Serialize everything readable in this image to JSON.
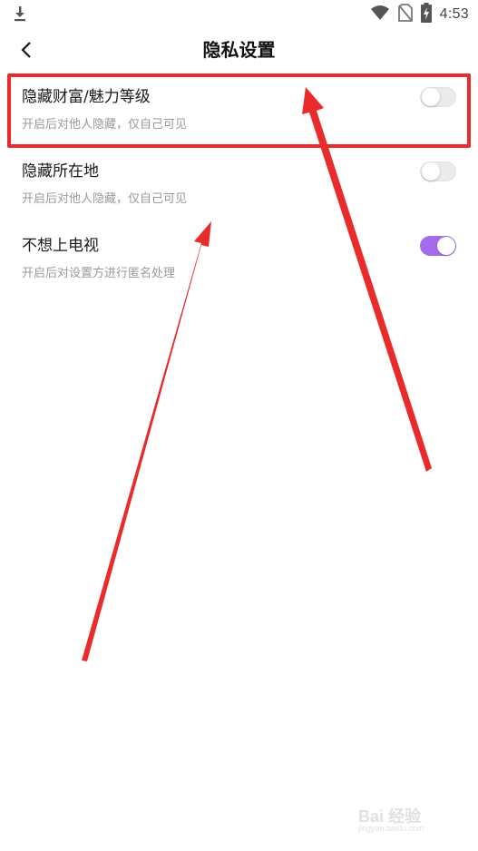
{
  "status_bar": {
    "time": "4:53",
    "icons": [
      "download-icon",
      "wifi-icon",
      "no-sim-icon",
      "battery-charging-icon"
    ]
  },
  "header": {
    "title": "隐私设置",
    "back_icon": "chevron-left-icon"
  },
  "settings": [
    {
      "title": "隐藏财富/魅力等级",
      "description": "开启后对他人隐藏，仅自己可见",
      "enabled": false
    },
    {
      "title": "隐藏所在地",
      "description": "开启后对他人隐藏，仅自己可见",
      "enabled": false
    },
    {
      "title": "不想上电视",
      "description": "开启后对设置方进行匿名处理",
      "enabled": true
    }
  ],
  "colors": {
    "accent": "#a46bec",
    "toggle_off": "#ebebeb",
    "annotation_red": "#ea2b2b"
  },
  "watermark": {
    "mark": "Bai 经验",
    "sub": "jingyan.baidu.com"
  }
}
